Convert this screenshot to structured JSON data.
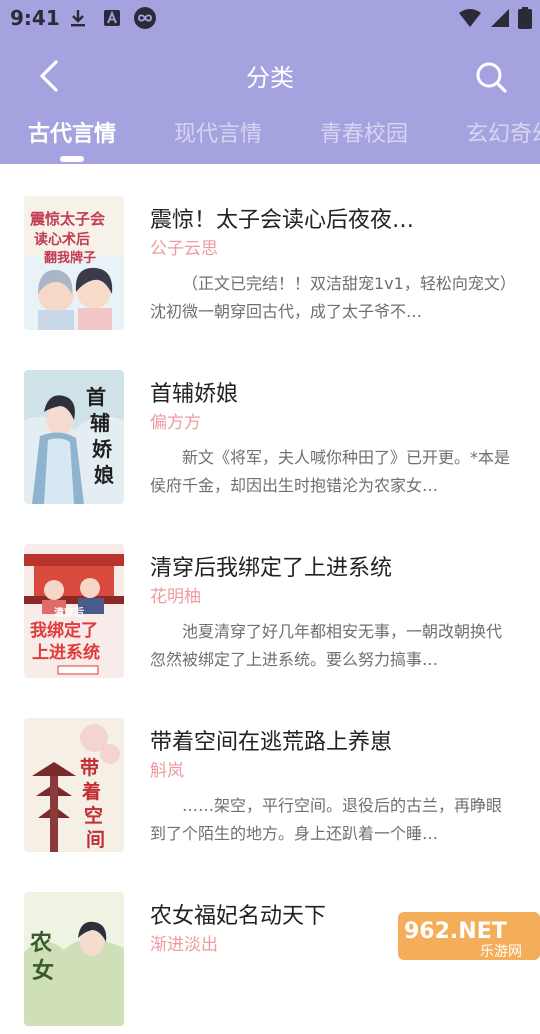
{
  "status_bar": {
    "time": "9:41"
  },
  "nav": {
    "title": "分类"
  },
  "tabs": [
    {
      "label": "古代言情"
    },
    {
      "label": "现代言情"
    },
    {
      "label": "青春校园"
    },
    {
      "label": "玄幻奇幻"
    }
  ],
  "books": [
    {
      "title": "震惊！太子会读心后夜夜…",
      "author": "公子云思",
      "desc": "（正文已完结！！双洁甜宠1v1，轻松向宠文）沈初微一朝穿回古代，成了太子爷不…",
      "cover_text": "震惊太子会读心术后翻我牌子"
    },
    {
      "title": "首辅娇娘",
      "author": "偏方方",
      "desc": "新文《将军，夫人喊你种田了》已开更。*本是侯府千金，却因出生时抱错沦为农家女…",
      "cover_text": "首辅娇娘"
    },
    {
      "title": "清穿后我绑定了上进系统",
      "author": "花明柚",
      "desc": "池夏清穿了好几年都相安无事，一朝改朝换代忽然被绑定了上进系统。要么努力搞事…",
      "cover_text": "清穿后我绑定了上进系统"
    },
    {
      "title": "带着空间在逃荒路上养崽",
      "author": "斛岚",
      "desc": "……架空，平行空间。退役后的古兰，再睁眼到了个陌生的地方。身上还趴着一个睡…",
      "cover_text": "带着空间"
    },
    {
      "title": "农女福妃名动天下",
      "author": "渐进淡出",
      "desc": "",
      "cover_text": "农女"
    }
  ],
  "watermark": {
    "main": "962.NET",
    "sub": "乐游网"
  }
}
